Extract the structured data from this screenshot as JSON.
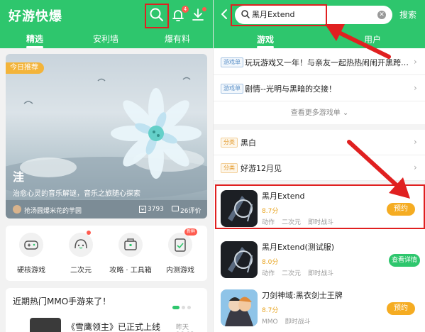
{
  "left": {
    "app_title": "好游快爆",
    "notification_badge": "4",
    "tabs": [
      "精选",
      "安利墙",
      "爆有料"
    ],
    "featured": {
      "tag": "今日推荐",
      "title": "洼",
      "subtitle": "治愈心灵的音乐解谜，音乐之旅随心探索",
      "user": "抢汤圆爆米花的芋圆",
      "downloads": "3793",
      "reviews": "26评价"
    },
    "categories": [
      {
        "label": "硬核游戏",
        "icon": "gamepad-icon"
      },
      {
        "label": "二次元",
        "icon": "anime-girl-icon"
      },
      {
        "label": "攻略 · 工具箱",
        "icon": "toolbox-icon"
      },
      {
        "label": "内测游戏",
        "icon": "beta-test-icon",
        "badge": "新鲜"
      }
    ],
    "news": {
      "title": "近期热门MMO手游来了！",
      "item": "《雪鹰领主》已正式上线",
      "time": "昨天 16:02"
    }
  },
  "right": {
    "search_value": "黑月Extend",
    "search_button": "搜索",
    "tabs": [
      "游戏",
      "用户"
    ],
    "lists": [
      {
        "tag": "游戏单",
        "text": "玩玩游戏又一年！与亲友一起热热闹闹开黑跨…"
      },
      {
        "tag": "游戏单",
        "text": "剧情--光明与黑暗的交接！"
      }
    ],
    "more_link": "查看更多游戏单",
    "categories": [
      {
        "tag": "分类",
        "text": "黑白"
      },
      {
        "tag": "分类",
        "text": "好游12月见"
      }
    ],
    "games": [
      {
        "name": "黑月Extend",
        "score": "8.7分",
        "tags": [
          "动作",
          "二次元",
          "即时战斗"
        ],
        "button": "预约"
      },
      {
        "name": "黑月Extend(测试服)",
        "score": "8.0分",
        "tags": [
          "动作",
          "二次元",
          "即时战斗"
        ],
        "button": "查看详情"
      },
      {
        "name": "刀剑神域:黑衣剑士王牌",
        "score": "8.7分",
        "tags": [
          "MMO",
          "即时战斗"
        ],
        "button": "预约"
      }
    ]
  },
  "colors": {
    "brand_green": "#2ec66d",
    "reserve_orange": "#f5ac22",
    "highlight_red": "#e02020"
  }
}
